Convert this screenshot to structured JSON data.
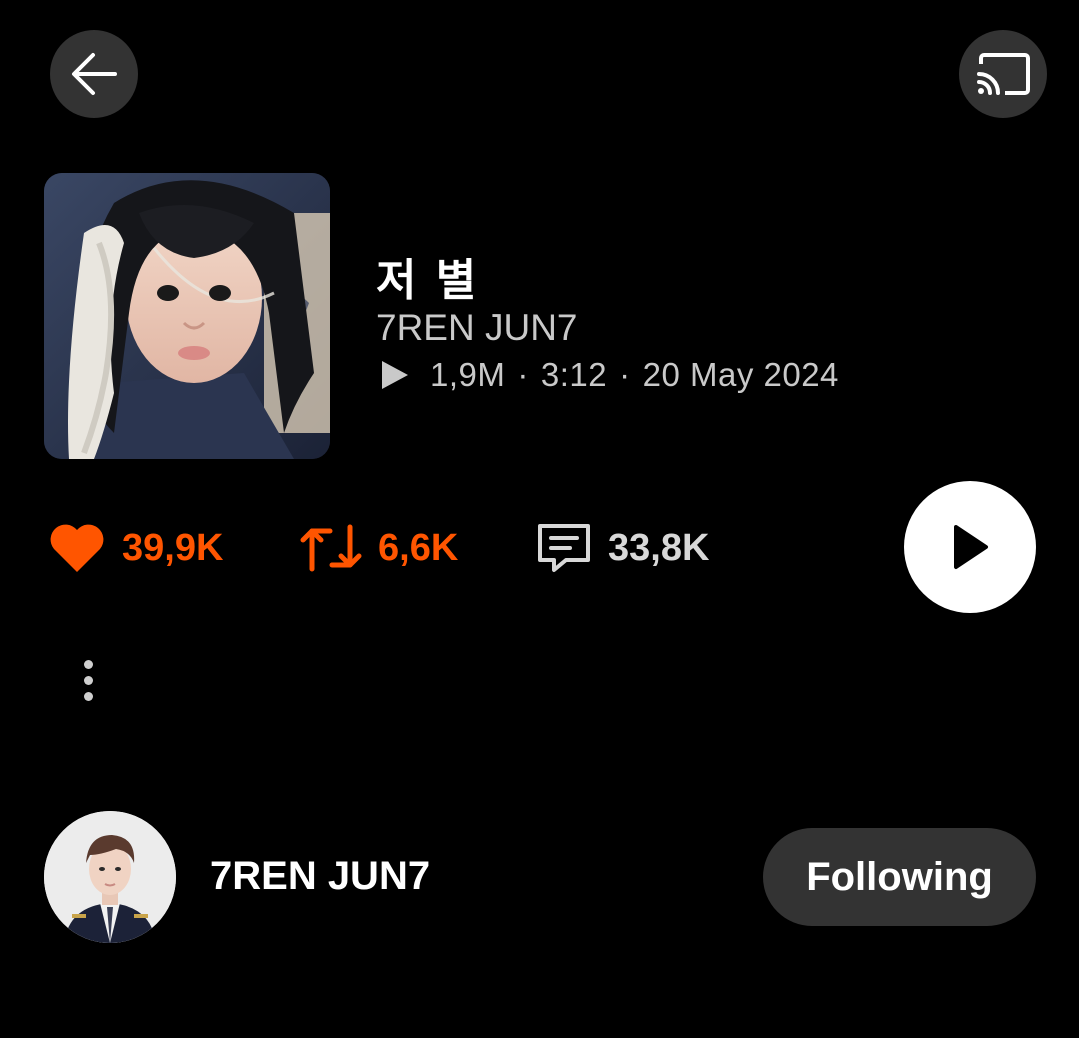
{
  "header": {
    "back_icon": "arrow-left-icon",
    "cast_icon": "cast-icon"
  },
  "track": {
    "title": "저 별",
    "artist": "7REN JUN7",
    "plays": "1,9M",
    "separator": "·",
    "duration": "3:12",
    "date": "20 May 2024"
  },
  "stats": {
    "likes": "39,9K",
    "reposts": "6,6K",
    "comments": "33,8K"
  },
  "user": {
    "name": "7REN JUN7",
    "follow_label": "Following"
  },
  "colors": {
    "accent": "#ff5500",
    "background": "#000000",
    "button_bg": "#333333",
    "muted_text": "#c9c9c9"
  }
}
